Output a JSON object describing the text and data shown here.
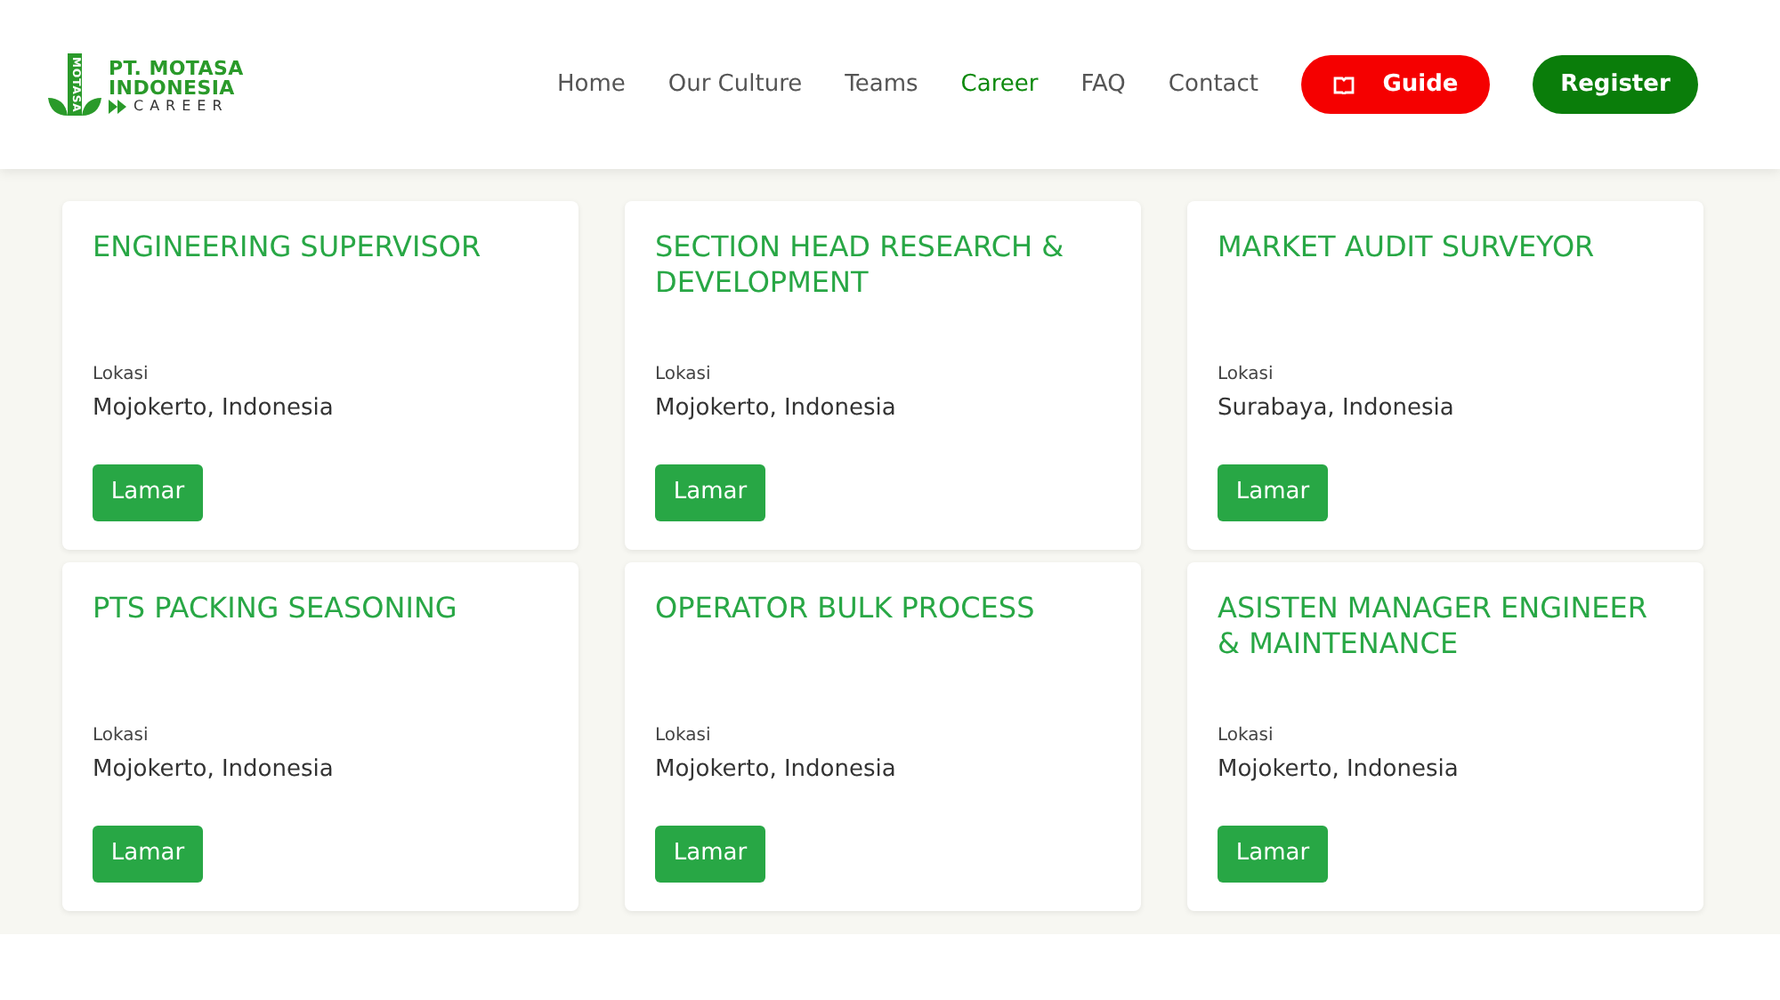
{
  "logo": {
    "mark_text": "MOTASA",
    "line_1": "PT. MOTASA",
    "line_2": "INDONESIA",
    "line_3": "CAREER"
  },
  "nav": [
    {
      "label": "Home",
      "selected": false
    },
    {
      "label": "Our Culture",
      "selected": false
    },
    {
      "label": "Teams",
      "selected": false
    },
    {
      "label": "Career",
      "selected": true
    },
    {
      "label": "FAQ",
      "selected": false
    },
    {
      "label": "Contact",
      "selected": false
    }
  ],
  "guide_button": "Guide",
  "register_button": "Register",
  "jobs": [
    {
      "title": "ENGINEERING SUPERVISOR",
      "location_label": "Lokasi",
      "location": "Mojokerto, Indonesia",
      "button": "Lamar"
    },
    {
      "title": "SECTION HEAD RESEARCH & DEVELOPMENT",
      "location_label": "Lokasi",
      "location": "Mojokerto, Indonesia",
      "button": "Lamar"
    },
    {
      "title": "MARKET AUDIT SURVEYOR",
      "location_label": "Lokasi",
      "location": "Surabaya, Indonesia",
      "button": "Lamar"
    },
    {
      "title": "PTS PACKING SEASONING",
      "location_label": "Lokasi",
      "location": "Mojokerto, Indonesia",
      "button": "Lamar"
    },
    {
      "title": "OPERATOR BULK PROCESS",
      "location_label": "Lokasi",
      "location": "Mojokerto, Indonesia",
      "button": "Lamar"
    },
    {
      "title": "ASISTEN MANAGER ENGINEER & MAINTENANCE",
      "location_label": "Lokasi",
      "location": "Mojokerto, Indonesia",
      "button": "Lamar"
    }
  ]
}
